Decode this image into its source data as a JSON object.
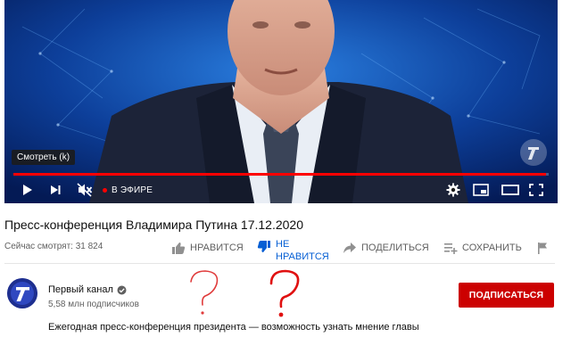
{
  "player": {
    "tooltip": "Смотреть (k)",
    "live_label": "В ЭФИРЕ",
    "progress_fraction": 0.995,
    "accent_color": "#ff0000",
    "icons": [
      "play-icon",
      "next-icon",
      "volume-muted-icon",
      "settings-icon",
      "miniplayer-icon",
      "theater-mode-icon",
      "fullscreen-icon",
      "channel-one-watermark-icon"
    ]
  },
  "video": {
    "title": "Пресс-конференция Владимира Путина 17.12.2020",
    "viewers": "Сейчас смотрят: 31 824"
  },
  "actions": {
    "like": "НРАВИТСЯ",
    "dislike_line1": "НЕ",
    "dislike_line2": "НРАВИТСЯ",
    "share": "ПОДЕЛИТЬСЯ",
    "save": "СОХРАНИТЬ",
    "dislike_color": "#065fd4"
  },
  "channel": {
    "name": "Первый канал",
    "subscribers": "5,58 млн подписчиков",
    "subscribe_label": "ПОДПИСАТЬСЯ",
    "subscribe_color": "#cc0000"
  },
  "description": {
    "text": "Ежегодная пресс-конференция президента — возможность узнать мнение главы"
  }
}
